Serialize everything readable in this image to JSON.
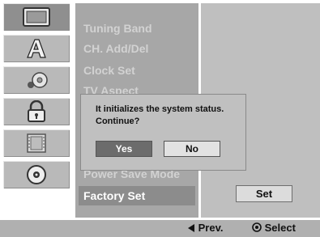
{
  "sidebar": {
    "icons": [
      {
        "name": "tv-screen-icon",
        "selected": true
      },
      {
        "name": "language-a-icon",
        "selected": false
      },
      {
        "name": "audio-disc-icon",
        "selected": false
      },
      {
        "name": "lock-icon",
        "selected": false
      },
      {
        "name": "film-icon",
        "selected": false
      },
      {
        "name": "disc-icon",
        "selected": false
      }
    ]
  },
  "menu": {
    "items": [
      "Tuning Band",
      "CH. Add/Del",
      "Clock Set",
      "TV Aspect",
      "Power Save Mode",
      "Factory Set"
    ],
    "selected": "Factory Set"
  },
  "right_panel": {
    "set_label": "Set"
  },
  "dialog": {
    "line1": "It initializes the system status.",
    "line2": "Continue?",
    "yes_label": "Yes",
    "no_label": "No",
    "selected": "Yes"
  },
  "footer": {
    "prev_label": "Prev.",
    "select_label": "Select"
  },
  "colors": {
    "menu_text": "#d2d2d2",
    "selected_bg": "#8c8c8c",
    "dialog_bg": "#c0c0c0"
  }
}
